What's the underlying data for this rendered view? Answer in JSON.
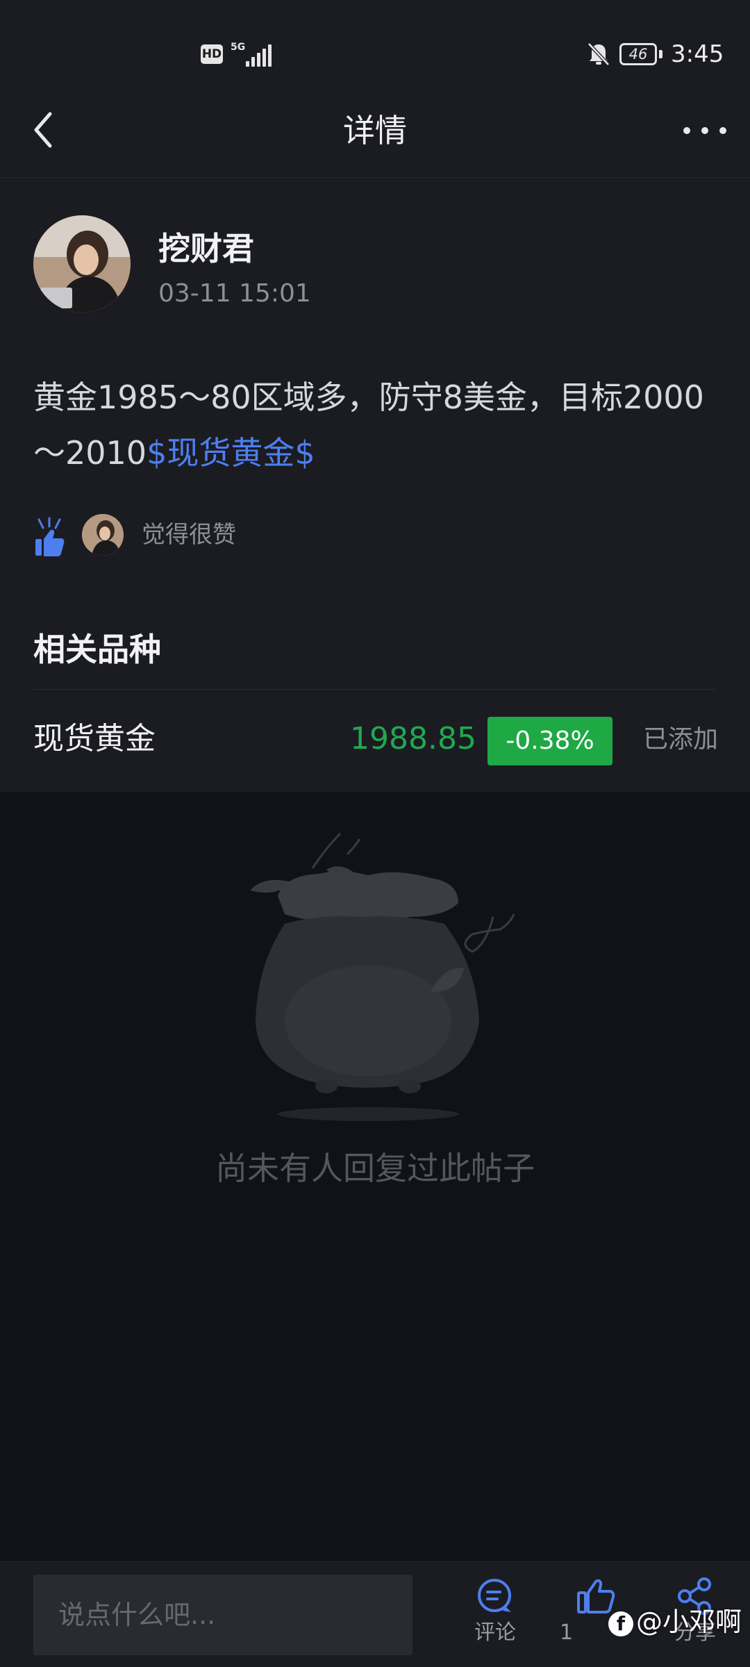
{
  "status_bar": {
    "hd_label": "HD",
    "network_label": "5G",
    "battery": "46",
    "time": "3:45"
  },
  "nav": {
    "title": "详情"
  },
  "post": {
    "author": "挖财君",
    "time": "03-11 15:01",
    "body_text": "黄金1985～80区域多，防守8美金，目标2000～2010",
    "tag": "$现货黄金$",
    "like_text": "觉得很赞"
  },
  "related": {
    "title": "相关品种",
    "instrument": {
      "name": "现货黄金",
      "price": "1988.85",
      "change": "-0.38%",
      "status": "已添加"
    }
  },
  "empty_state": {
    "text": "尚未有人回复过此帖子"
  },
  "bottom_bar": {
    "input_placeholder": "说点什么吧...",
    "comment_label": "评论",
    "like_count": "1",
    "share_label": "分享"
  },
  "watermark": {
    "text": "@小邓啊"
  },
  "colors": {
    "accent_blue": "#4d7ff0",
    "price_green": "#21a950",
    "change_badge_green": "#1ea945",
    "background": "#111218",
    "card": "#1b1c22"
  }
}
